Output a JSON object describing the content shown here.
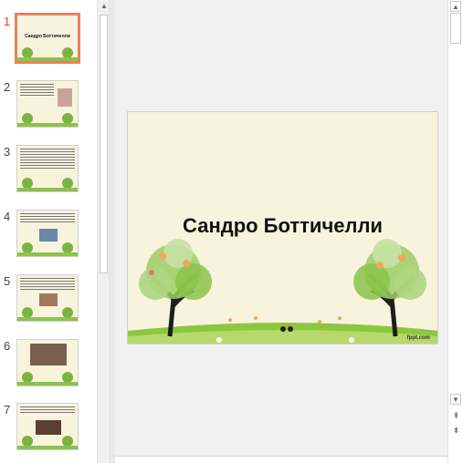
{
  "thumbnails": [
    {
      "number": "1",
      "title": "Сандро Боттичелли"
    },
    {
      "number": "2"
    },
    {
      "number": "3"
    },
    {
      "number": "4"
    },
    {
      "number": "5"
    },
    {
      "number": "6"
    },
    {
      "number": "7"
    }
  ],
  "slide": {
    "title": "Сандро Боттичелли",
    "footer": "fppt.com"
  },
  "colors": {
    "selection_border": "#e4825f",
    "slide_background": "#f8f3dd",
    "active_number": "#d24726"
  }
}
